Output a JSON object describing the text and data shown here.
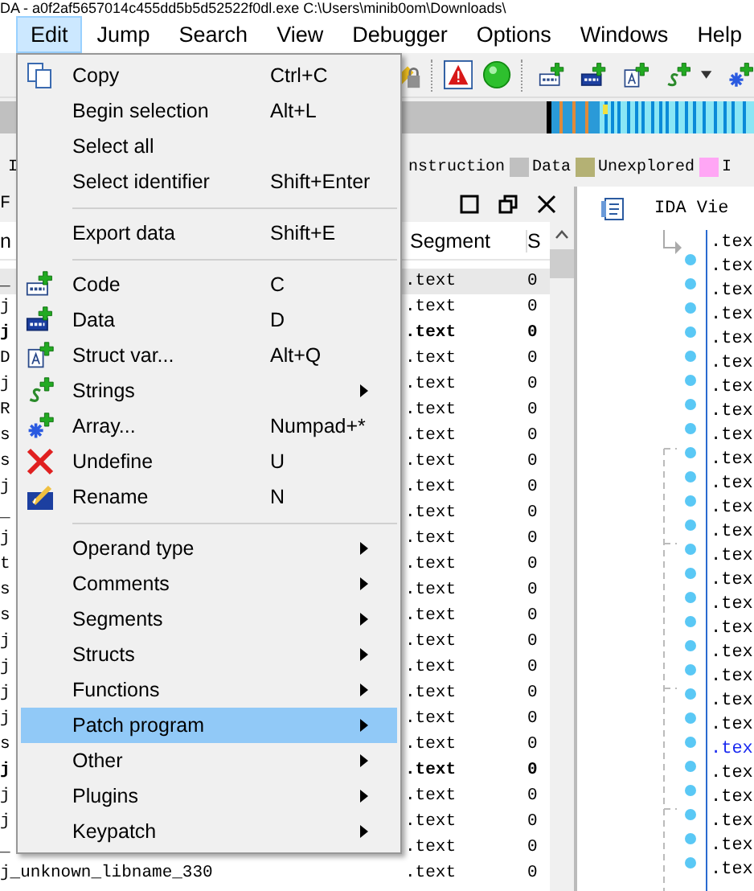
{
  "window": {
    "title": "DA - a0f2af5657014c455dd5b5d52522f0dl.exe C:\\Users\\minib0om\\Downloads\\"
  },
  "menu_bar": [
    {
      "label": "Edit",
      "selected": true
    },
    {
      "label": "Jump",
      "selected": false
    },
    {
      "label": "Search",
      "selected": false
    },
    {
      "label": "View",
      "selected": false
    },
    {
      "label": "Debugger",
      "selected": false
    },
    {
      "label": "Options",
      "selected": false
    },
    {
      "label": "Windows",
      "selected": false
    },
    {
      "label": "Help",
      "selected": false
    }
  ],
  "legend": {
    "left_text": "I",
    "items": [
      {
        "label": "nstruction"
      },
      {
        "color": "#c0c0c0",
        "label": "Data"
      },
      {
        "color": "#b4b174",
        "label": "Unexplored"
      },
      {
        "color": "#ffa6f5",
        "label": "I"
      }
    ]
  },
  "functions_window": {
    "title": "F",
    "columns": [
      "n",
      "Segment",
      "S"
    ],
    "rows": [
      {
        "name": "_",
        "segment": ".text",
        "start": "0",
        "bold": false,
        "selected": true
      },
      {
        "name": "j",
        "segment": ".text",
        "start": "0",
        "bold": false,
        "selected": false
      },
      {
        "name": "j",
        "segment": ".text",
        "start": "0",
        "bold": true,
        "selected": false
      },
      {
        "name": "D",
        "segment": ".text",
        "start": "0",
        "bold": false,
        "selected": false
      },
      {
        "name": "j",
        "segment": ".text",
        "start": "0",
        "bold": false,
        "selected": false
      },
      {
        "name": "R",
        "segment": ".text",
        "start": "0",
        "bold": false,
        "selected": false
      },
      {
        "name": "s",
        "segment": ".text",
        "start": "0",
        "bold": false,
        "selected": false
      },
      {
        "name": "s",
        "segment": ".text",
        "start": "0",
        "bold": false,
        "selected": false
      },
      {
        "name": "j",
        "segment": ".text",
        "start": "0",
        "bold": false,
        "selected": false
      },
      {
        "name": "_",
        "segment": ".text",
        "start": "0",
        "bold": false,
        "selected": false
      },
      {
        "name": "j",
        "segment": ".text",
        "start": "0",
        "bold": false,
        "selected": false
      },
      {
        "name": "t",
        "segment": ".text",
        "start": "0",
        "bold": false,
        "selected": false
      },
      {
        "name": "s",
        "segment": ".text",
        "start": "0",
        "bold": false,
        "selected": false
      },
      {
        "name": "s",
        "segment": ".text",
        "start": "0",
        "bold": false,
        "selected": false
      },
      {
        "name": "j",
        "segment": ".text",
        "start": "0",
        "bold": false,
        "selected": false
      },
      {
        "name": "j",
        "segment": ".text",
        "start": "0",
        "bold": false,
        "selected": false
      },
      {
        "name": "j",
        "segment": ".text",
        "start": "0",
        "bold": false,
        "selected": false
      },
      {
        "name": "j",
        "segment": ".text",
        "start": "0",
        "bold": false,
        "selected": false
      },
      {
        "name": "s",
        "segment": ".text",
        "start": "0",
        "bold": false,
        "selected": false
      },
      {
        "name": "j",
        "segment": ".text",
        "start": "0",
        "bold": true,
        "selected": false
      },
      {
        "name": "j",
        "segment": ".text",
        "start": "0",
        "bold": false,
        "selected": false
      },
      {
        "name": "j",
        "segment": ".text",
        "start": "0",
        "bold": false,
        "selected": false
      },
      {
        "name": "_",
        "segment": ".text",
        "start": "0",
        "bold": false,
        "selected": false
      },
      {
        "name": "j_unknown_libname_330",
        "segment": ".text",
        "start": "0",
        "bold": false,
        "selected": false
      }
    ]
  },
  "ida_view": {
    "tab": "IDA Vie",
    "lines": [
      {
        "text": ".tex",
        "bullet": false,
        "highlighted": false
      },
      {
        "text": ".tex",
        "bullet": true,
        "highlighted": false
      },
      {
        "text": ".tex",
        "bullet": true,
        "highlighted": false
      },
      {
        "text": ".tex",
        "bullet": true,
        "highlighted": false
      },
      {
        "text": ".tex",
        "bullet": true,
        "highlighted": false
      },
      {
        "text": ".tex",
        "bullet": true,
        "highlighted": false
      },
      {
        "text": ".tex",
        "bullet": true,
        "highlighted": false
      },
      {
        "text": ".tex",
        "bullet": true,
        "highlighted": false
      },
      {
        "text": ".tex",
        "bullet": true,
        "highlighted": false
      },
      {
        "text": ".tex",
        "bullet": true,
        "highlighted": false
      },
      {
        "text": ".tex",
        "bullet": true,
        "highlighted": false
      },
      {
        "text": ".tex",
        "bullet": true,
        "highlighted": false
      },
      {
        "text": ".tex",
        "bullet": true,
        "highlighted": false
      },
      {
        "text": ".tex",
        "bullet": true,
        "highlighted": false
      },
      {
        "text": ".tex",
        "bullet": true,
        "highlighted": false
      },
      {
        "text": ".tex",
        "bullet": true,
        "highlighted": false
      },
      {
        "text": ".tex",
        "bullet": true,
        "highlighted": false
      },
      {
        "text": ".tex",
        "bullet": true,
        "highlighted": false
      },
      {
        "text": ".tex",
        "bullet": true,
        "highlighted": false
      },
      {
        "text": ".tex",
        "bullet": true,
        "highlighted": false
      },
      {
        "text": ".tex",
        "bullet": true,
        "highlighted": false
      },
      {
        "text": ".tex",
        "bullet": true,
        "highlighted": true
      },
      {
        "text": ".tex",
        "bullet": true,
        "highlighted": false
      },
      {
        "text": ".tex",
        "bullet": true,
        "highlighted": false
      },
      {
        "text": ".tex",
        "bullet": true,
        "highlighted": false
      },
      {
        "text": ".tex",
        "bullet": true,
        "highlighted": false
      },
      {
        "text": ".tex",
        "bullet": true,
        "highlighted": false
      }
    ]
  },
  "edit_menu": [
    {
      "kind": "item",
      "label": "Copy",
      "shortcut": "Ctrl+C",
      "submenu": false,
      "selected": false
    },
    {
      "kind": "item",
      "label": "Begin selection",
      "shortcut": "Alt+L",
      "submenu": false,
      "selected": false
    },
    {
      "kind": "item",
      "label": "Select all",
      "submenu": false,
      "selected": false
    },
    {
      "kind": "item",
      "label": "Select identifier",
      "shortcut": "Shift+Enter",
      "submenu": false,
      "selected": false
    },
    {
      "kind": "separator"
    },
    {
      "kind": "item",
      "label": "Export data",
      "shortcut": "Shift+E",
      "submenu": false,
      "selected": false
    },
    {
      "kind": "separator"
    },
    {
      "kind": "item",
      "label": "Code",
      "shortcut": "C",
      "submenu": false,
      "selected": false
    },
    {
      "kind": "item",
      "label": "Data",
      "shortcut": "D",
      "submenu": false,
      "selected": false
    },
    {
      "kind": "item",
      "label": "Struct var...",
      "shortcut": "Alt+Q",
      "submenu": false,
      "selected": false
    },
    {
      "kind": "item",
      "label": "Strings",
      "submenu": true,
      "selected": false
    },
    {
      "kind": "item",
      "label": "Array...",
      "shortcut": "Numpad+*",
      "submenu": false,
      "selected": false
    },
    {
      "kind": "item",
      "label": "Undefine",
      "shortcut": "U",
      "submenu": false,
      "selected": false
    },
    {
      "kind": "item",
      "label": "Rename",
      "shortcut": "N",
      "submenu": false,
      "selected": false
    },
    {
      "kind": "separator"
    },
    {
      "kind": "item",
      "label": "Operand type",
      "submenu": true,
      "selected": false
    },
    {
      "kind": "item",
      "label": "Comments",
      "submenu": true,
      "selected": false
    },
    {
      "kind": "item",
      "label": "Segments",
      "submenu": true,
      "selected": false
    },
    {
      "kind": "item",
      "label": "Structs",
      "submenu": true,
      "selected": false
    },
    {
      "kind": "item",
      "label": "Functions",
      "submenu": true,
      "selected": false
    },
    {
      "kind": "item",
      "label": "Patch program",
      "submenu": true,
      "selected": true
    },
    {
      "kind": "item",
      "label": "Other",
      "submenu": true,
      "selected": false
    },
    {
      "kind": "item",
      "label": "Plugins",
      "submenu": true,
      "selected": false
    },
    {
      "kind": "item",
      "label": "Keypatch",
      "submenu": true,
      "selected": false
    }
  ]
}
